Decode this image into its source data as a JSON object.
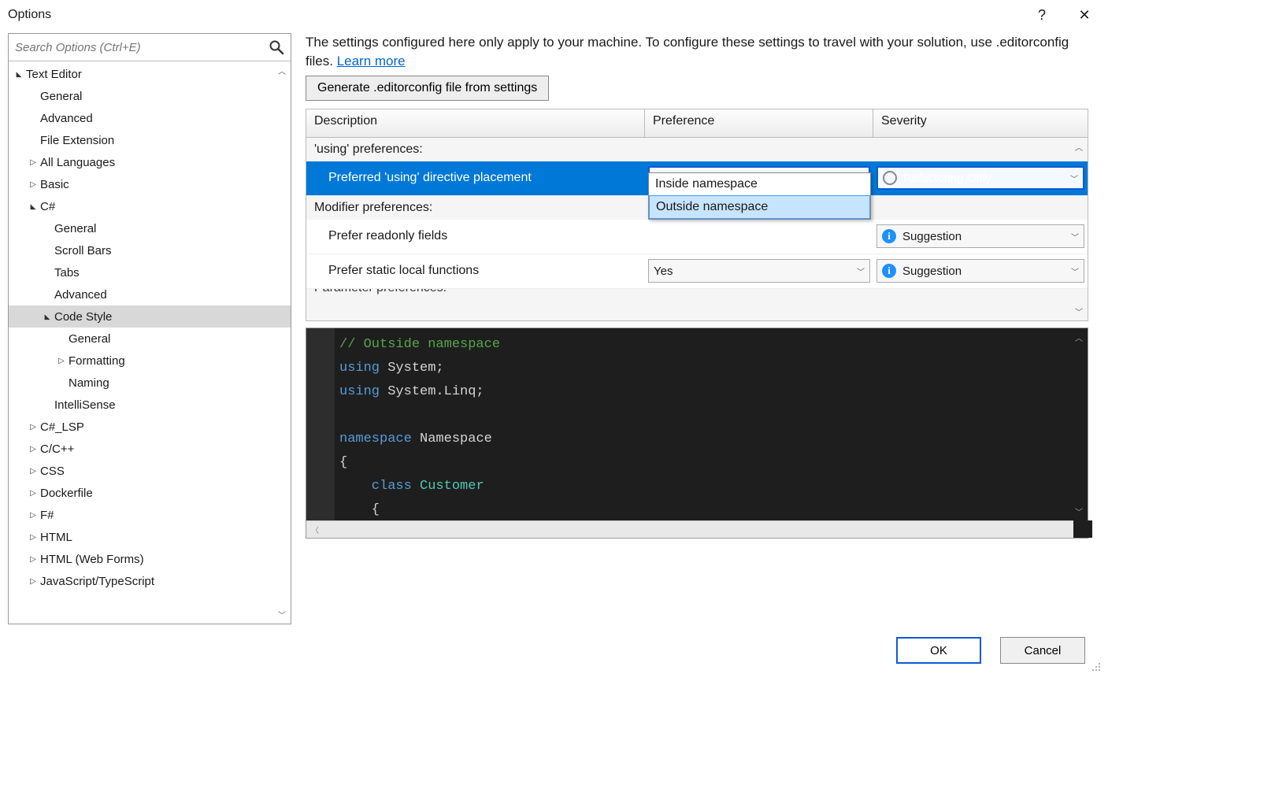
{
  "window": {
    "title": "Options",
    "help": "?",
    "close": "✕"
  },
  "search": {
    "placeholder": "Search Options (Ctrl+E)"
  },
  "tree": [
    {
      "label": "Text Editor",
      "depth": 0,
      "toggle": "▲",
      "expanded": true
    },
    {
      "label": "General",
      "depth": 1,
      "toggle": ""
    },
    {
      "label": "Advanced",
      "depth": 1,
      "toggle": ""
    },
    {
      "label": "File Extension",
      "depth": 1,
      "toggle": ""
    },
    {
      "label": "All Languages",
      "depth": 1,
      "toggle": "▷"
    },
    {
      "label": "Basic",
      "depth": 1,
      "toggle": "▷"
    },
    {
      "label": "C#",
      "depth": 1,
      "toggle": "▲",
      "expanded": true
    },
    {
      "label": "General",
      "depth": 2,
      "toggle": ""
    },
    {
      "label": "Scroll Bars",
      "depth": 2,
      "toggle": ""
    },
    {
      "label": "Tabs",
      "depth": 2,
      "toggle": ""
    },
    {
      "label": "Advanced",
      "depth": 2,
      "toggle": ""
    },
    {
      "label": "Code Style",
      "depth": 2,
      "toggle": "▲",
      "expanded": true,
      "selected": true
    },
    {
      "label": "General",
      "depth": 3,
      "toggle": ""
    },
    {
      "label": "Formatting",
      "depth": 3,
      "toggle": "▷"
    },
    {
      "label": "Naming",
      "depth": 3,
      "toggle": ""
    },
    {
      "label": "IntelliSense",
      "depth": 2,
      "toggle": ""
    },
    {
      "label": "C#_LSP",
      "depth": 1,
      "toggle": "▷"
    },
    {
      "label": "C/C++",
      "depth": 1,
      "toggle": "▷"
    },
    {
      "label": "CSS",
      "depth": 1,
      "toggle": "▷"
    },
    {
      "label": "Dockerfile",
      "depth": 1,
      "toggle": "▷"
    },
    {
      "label": "F#",
      "depth": 1,
      "toggle": "▷"
    },
    {
      "label": "HTML",
      "depth": 1,
      "toggle": "▷"
    },
    {
      "label": "HTML (Web Forms)",
      "depth": 1,
      "toggle": "▷"
    },
    {
      "label": "JavaScript/TypeScript",
      "depth": 1,
      "toggle": "▷"
    }
  ],
  "hint": {
    "text": "The settings configured here only apply to your machine. To configure these settings to travel with your solution, use .editorconfig files.  ",
    "link": "Learn more"
  },
  "generate_button": "Generate .editorconfig file from settings",
  "columns": {
    "desc": "Description",
    "pref": "Preference",
    "sev": "Severity"
  },
  "groups": [
    {
      "name": "'using' preferences:",
      "rows": [
        {
          "desc": "Preferred 'using' directive placement",
          "pref": "Outside namespace",
          "sev": "Refactoring Only",
          "sev_icon": "circle",
          "selected": true
        }
      ]
    },
    {
      "name": "Modifier preferences:",
      "rows": [
        {
          "desc": "Prefer readonly fields",
          "pref": "",
          "sev": "Suggestion",
          "sev_icon": "info"
        },
        {
          "desc": "Prefer static local functions",
          "pref": "Yes",
          "sev": "Suggestion",
          "sev_icon": "info"
        }
      ]
    },
    {
      "name_cut": "Parameter preferences:"
    }
  ],
  "dropdown": {
    "options": [
      {
        "label": "Inside namespace",
        "highlight": false
      },
      {
        "label": "Outside namespace",
        "highlight": true
      }
    ]
  },
  "code": {
    "lines": [
      {
        "segs": [
          {
            "t": "// Outside namespace",
            "c": "c-comment"
          }
        ]
      },
      {
        "segs": [
          {
            "t": "using ",
            "c": "c-keyword"
          },
          {
            "t": "System;",
            "c": ""
          }
        ]
      },
      {
        "segs": [
          {
            "t": "using ",
            "c": "c-keyword"
          },
          {
            "t": "System.Linq;",
            "c": ""
          }
        ]
      },
      {
        "segs": [
          {
            "t": "",
            "c": ""
          }
        ]
      },
      {
        "segs": [
          {
            "t": "namespace ",
            "c": "c-keyword"
          },
          {
            "t": "Namespace",
            "c": ""
          }
        ]
      },
      {
        "segs": [
          {
            "t": "{",
            "c": ""
          }
        ]
      },
      {
        "segs": [
          {
            "t": "    class ",
            "c": "c-keyword"
          },
          {
            "t": "Customer",
            "c": "c-type"
          }
        ]
      },
      {
        "segs": [
          {
            "t": "    {",
            "c": ""
          }
        ]
      },
      {
        "segs": [
          {
            "t": "    }",
            "c": ""
          }
        ]
      }
    ]
  },
  "footer": {
    "ok": "OK",
    "cancel": "Cancel"
  }
}
